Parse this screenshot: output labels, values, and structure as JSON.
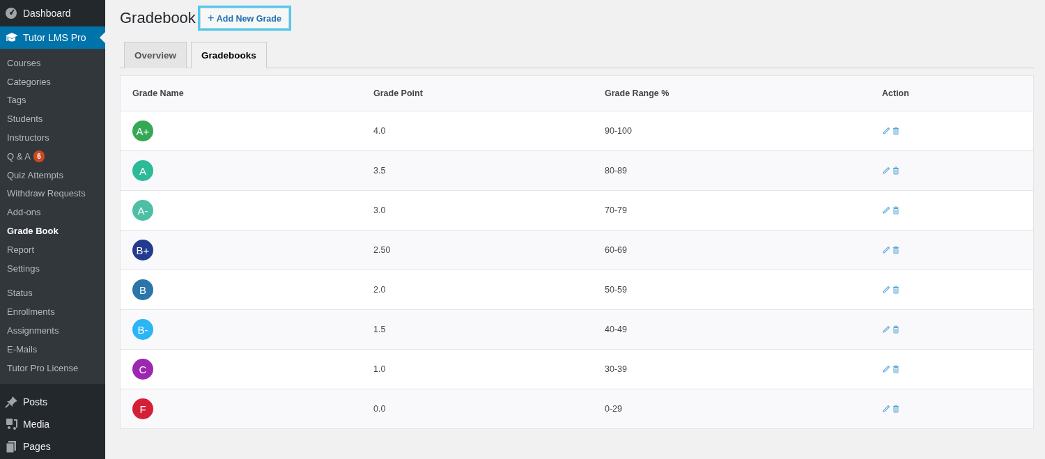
{
  "sidebar": {
    "top_items": [
      {
        "label": "Dashboard",
        "kind": "gauge",
        "selected": false
      },
      {
        "label": "Tutor LMS Pro",
        "kind": "cap",
        "selected": true
      }
    ],
    "submenu_groups": [
      [
        {
          "label": "Courses",
          "selected": false
        },
        {
          "label": "Categories",
          "selected": false
        },
        {
          "label": "Tags",
          "selected": false
        },
        {
          "label": "Students",
          "selected": false
        },
        {
          "label": "Instructors",
          "selected": false
        },
        {
          "label": "Q & A",
          "badge": "6",
          "selected": false
        },
        {
          "label": "Quiz Attempts",
          "selected": false
        },
        {
          "label": "Withdraw Requests",
          "selected": false
        },
        {
          "label": "Add-ons",
          "selected": false
        },
        {
          "label": "Grade Book",
          "selected": true
        },
        {
          "label": "Report",
          "selected": false
        },
        {
          "label": "Settings",
          "selected": false
        }
      ],
      [
        {
          "label": "Status",
          "selected": false
        },
        {
          "label": "Enrollments",
          "selected": false
        },
        {
          "label": "Assignments",
          "selected": false
        },
        {
          "label": "E-Mails",
          "selected": false
        },
        {
          "label": "Tutor Pro License",
          "selected": false
        }
      ]
    ],
    "bottom_items": [
      {
        "label": "Posts",
        "kind": "pin",
        "selected": false
      },
      {
        "label": "Media",
        "kind": "media",
        "selected": false
      },
      {
        "label": "Pages",
        "kind": "pages",
        "selected": false
      }
    ]
  },
  "page": {
    "title": "Gradebook",
    "add_button": {
      "icon": "+",
      "label": "Add New Grade"
    }
  },
  "tabs": [
    {
      "label": "Overview",
      "selected": false
    },
    {
      "label": "Gradebooks",
      "selected": true
    }
  ],
  "table": {
    "columns": [
      "Grade Name",
      "Grade Point",
      "Grade Range %",
      "Action"
    ],
    "rows": [
      {
        "grade": "A+",
        "color": "#34a853",
        "point": "4.0",
        "range": "90-100"
      },
      {
        "grade": "A",
        "color": "#2bbb97",
        "point": "3.5",
        "range": "80-89"
      },
      {
        "grade": "A-",
        "color": "#4dbfa4",
        "point": "3.0",
        "range": "70-79"
      },
      {
        "grade": "B+",
        "color": "#233b8e",
        "point": "2.50",
        "range": "60-69"
      },
      {
        "grade": "B",
        "color": "#2a75aa",
        "point": "2.0",
        "range": "50-59"
      },
      {
        "grade": "B-",
        "color": "#2bb5f5",
        "point": "1.5",
        "range": "40-49"
      },
      {
        "grade": "C",
        "color": "#9c27b0",
        "point": "1.0",
        "range": "30-39"
      },
      {
        "grade": "F",
        "color": "#d51f37",
        "point": "0.0",
        "range": "0-29"
      }
    ]
  }
}
